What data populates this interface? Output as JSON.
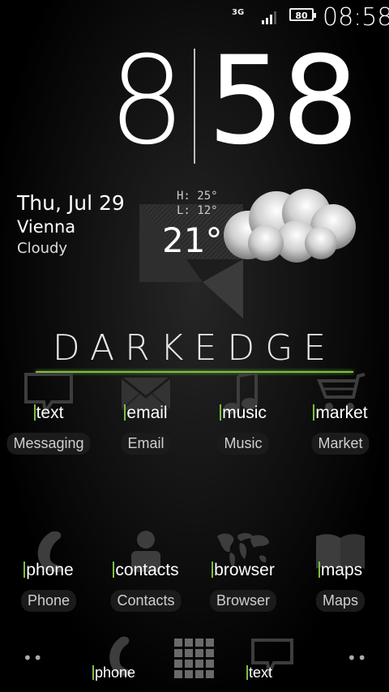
{
  "status_bar": {
    "network": "3G",
    "battery": "80",
    "time": "08:58"
  },
  "clock": {
    "hour": "8",
    "minute": "58"
  },
  "weather": {
    "date": "Thu, Jul 29",
    "city": "Vienna",
    "condition": "Cloudy",
    "high": "H:  25°",
    "low": "L:  12°",
    "temperature": "21°"
  },
  "brand": "DARKEDGE",
  "apps_row1": [
    {
      "tag": "text",
      "label": "Messaging",
      "icon": "message-icon"
    },
    {
      "tag": "email",
      "label": "Email",
      "icon": "envelope-icon"
    },
    {
      "tag": "music",
      "label": "Music",
      "icon": "music-note-icon"
    },
    {
      "tag": "market",
      "label": "Market",
      "icon": "shopping-cart-icon"
    }
  ],
  "apps_row2": [
    {
      "tag": "phone",
      "label": "Phone",
      "icon": "phone-handset-icon"
    },
    {
      "tag": "contacts",
      "label": "Contacts",
      "icon": "person-icon"
    },
    {
      "tag": "browser",
      "label": "Browser",
      "icon": "world-map-icon"
    },
    {
      "tag": "maps",
      "label": "Maps",
      "icon": "book-map-icon"
    }
  ],
  "dock": {
    "left_tag": "phone",
    "right_tag": "text",
    "app_drawer_icon": "grid-icon",
    "dots_left": "••",
    "dots_right": "••"
  },
  "colors": {
    "accent": "#7ac142",
    "background": "#000000"
  }
}
